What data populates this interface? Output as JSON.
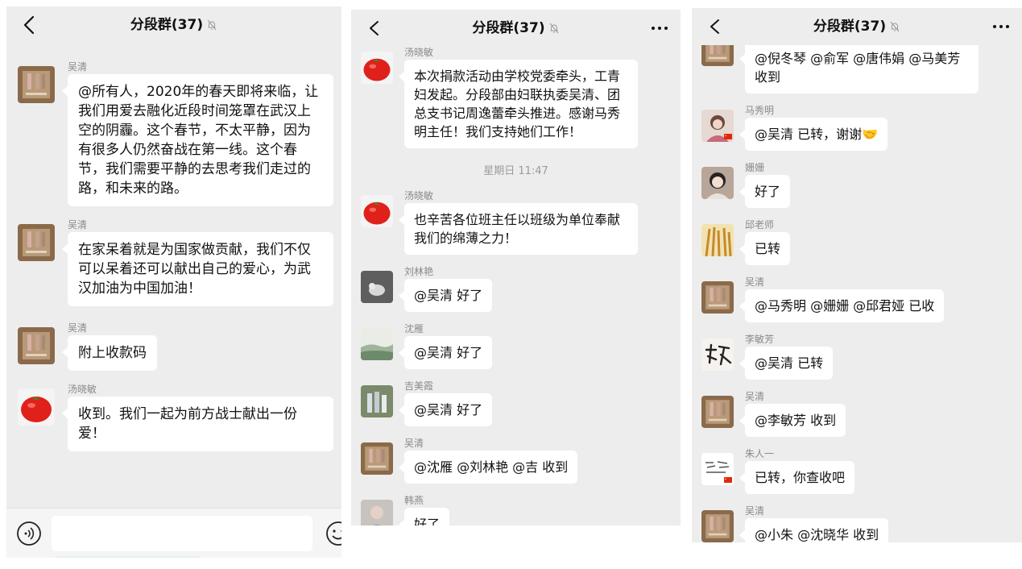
{
  "chat_title": "分段群(37)",
  "panel1": {
    "messages": [
      {
        "sender": "吴清",
        "avatar": "photo-avatar-wuqing",
        "text": "@所有人，2020年的春天即将来临，让我们用爱去融化近段时间笼罩在武汉上空的阴霾。这个春节，不太平静，因为有很多人仍然奋战在第一线。这个春节，我们需要平静的去思考我们走过的路，和未来的路。"
      },
      {
        "sender": "吴清",
        "avatar": "photo-avatar-wuqing",
        "text": "在家呆着就是为国家做贡献，我们不仅可以呆着还可以献出自己的爱心，为武汉加油为中国加油！"
      },
      {
        "sender": "吴清",
        "avatar": "photo-avatar-wuqing",
        "text": "附上收款码"
      },
      {
        "sender": "汤晓敏",
        "avatar": "tomato-avatar",
        "text": "收到。我们一起为前方战士献出一份爱！"
      }
    ],
    "input_placeholder": ""
  },
  "panel2": {
    "messages": [
      {
        "sender": "汤晓敏",
        "avatar": "tomato-avatar",
        "text": "本次捐款活动由学校党委牵头，工青妇发起。分段部由妇联执委吴清、团总支书记周逸蕾牵头推进。感谢马秀明主任！我们支持她们工作！"
      },
      {
        "sender": "汤晓敏",
        "avatar": "tomato-avatar",
        "text": "也辛苦各位班主任以班级为单位奉献我们的绵薄之力！"
      },
      {
        "sender": "刘林艳",
        "avatar": "photo-avatar-bird",
        "text": "@吴清 好了"
      },
      {
        "sender": "沈雁",
        "avatar": "photo-avatar-landscape",
        "text": "@吴清 好了"
      },
      {
        "sender": "吉美霞",
        "avatar": "photo-avatar-bottles",
        "text": "@吴清 好了"
      },
      {
        "sender": "吴清",
        "avatar": "photo-avatar-wuqing",
        "text": "@沈雁 @刘林艳 @吉 收到"
      },
      {
        "sender": "韩燕",
        "avatar": "photo-avatar-person",
        "text": "好了"
      }
    ],
    "timestamp": "星期日 11:47"
  },
  "panel3": {
    "messages": [
      {
        "sender": "",
        "avatar": "photo-avatar-wuqing",
        "text": "@倪冬琴 @俞军 @唐伟娟 @马美芳 收到"
      },
      {
        "sender": "马秀明",
        "avatar": "photo-avatar-woman-flag",
        "text": "@吴清 已转，谢谢🤝"
      },
      {
        "sender": "姗姗",
        "avatar": "photo-avatar-woman",
        "text": "好了"
      },
      {
        "sender": "邱老师",
        "avatar": "photo-avatar-wheat",
        "text": "已转"
      },
      {
        "sender": "吴清",
        "avatar": "photo-avatar-wuqing",
        "text": "@马秀明 @姗姗 @邱君娅 已收"
      },
      {
        "sender": "李敏芳",
        "avatar": "calligraphy-avatar",
        "text": "@吴清 已转"
      },
      {
        "sender": "吴清",
        "avatar": "photo-avatar-wuqing",
        "text": "@李敏芳 收到"
      },
      {
        "sender": "朱人一",
        "avatar": "handwriting-avatar-flag",
        "text": "已转，你查收吧"
      },
      {
        "sender": "吴清",
        "avatar": "photo-avatar-wuqing",
        "text": "@小朱 @沈晓华 收到"
      }
    ]
  },
  "icons": {
    "back": "chevron-left-icon",
    "mute": "bell-off-icon",
    "more": "more-dots-icon",
    "voice": "voice-icon",
    "emoji": "emoji-icon"
  },
  "colors": {
    "background": "#ededed",
    "bubble": "#ffffff",
    "name": "#8a8a8a",
    "time": "#9b9b9b"
  }
}
